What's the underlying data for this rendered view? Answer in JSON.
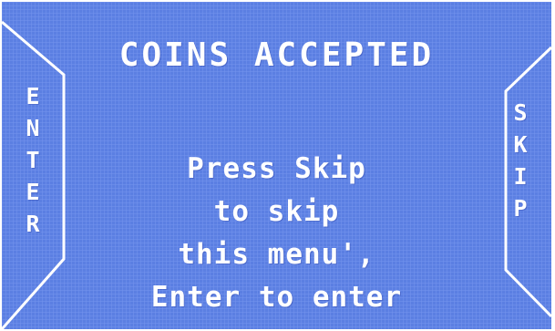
{
  "screen": {
    "title": "COINS ACCEPTED",
    "message_lines": [
      "Press Skip",
      "to skip",
      "this menu',",
      "Enter to enter"
    ]
  },
  "buttons": {
    "enter_letters": [
      "E",
      "N",
      "T",
      "E",
      "R"
    ],
    "skip_letters": [
      "S",
      "K",
      "I",
      "P"
    ]
  },
  "colors": {
    "background": "#5b7fe2",
    "text": "#ffffff"
  }
}
